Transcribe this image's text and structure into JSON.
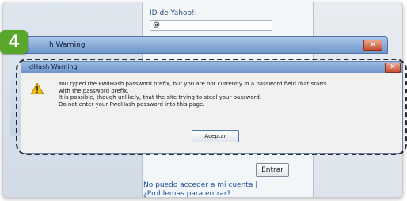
{
  "background_page": {
    "yahoo_label": "ID de Yahoo!:",
    "yahoo_value": "@",
    "entrar_label": "Entrar",
    "help_link_lines": [
      "No puedo acceder a mi cuenta |",
      "¿Problemas para entrar?"
    ]
  },
  "outer_window": {
    "title": "h Warning",
    "close_glyph": "✕"
  },
  "dialog": {
    "title": "dHash Warning",
    "close_glyph": "✕",
    "message_lines": [
      "You typed the PwdHash password prefix, but you are not currently in a password field that starts",
      "with the password prefix.",
      "It is possible, though unlikely, that the site trying to steal your password.",
      "Do not enter your PwdHash password into this page."
    ],
    "accept_label": "Aceptar",
    "icon": "warning-icon"
  },
  "step_badge": "4",
  "colors": {
    "badge_green": "#5aa62a",
    "titlebar_blue": "#6f97cb",
    "close_red": "#c74f33",
    "link_blue": "#1e4e9a"
  }
}
